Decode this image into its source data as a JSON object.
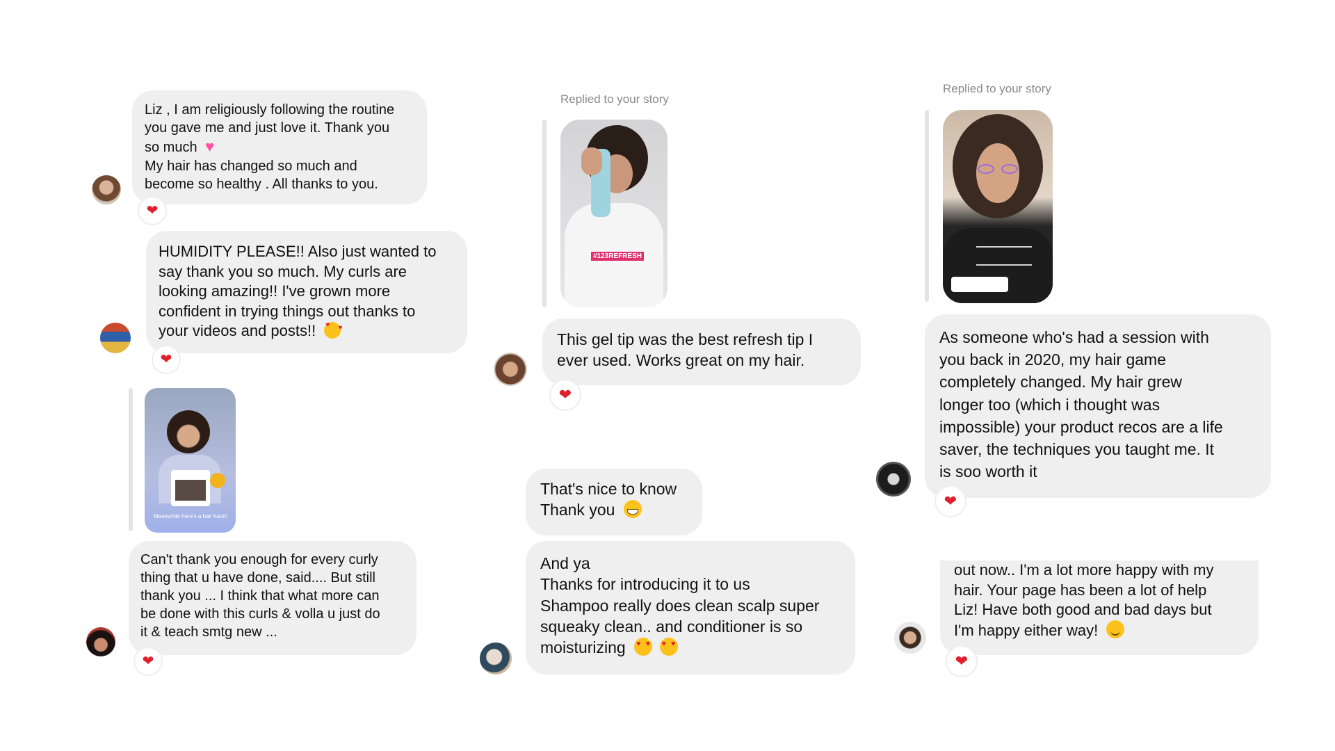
{
  "col1": {
    "msg1": {
      "lines": [
        "Liz , I am religiously following the routine",
        "you gave me and just love it. Thank you",
        "so much",
        "My hair has changed so much and",
        "become so healthy . All thanks to you."
      ],
      "emoji": "pink-heart"
    },
    "msg2": {
      "lines": [
        "HUMIDITY PLEASE!! Also just wanted to",
        "say thank you so much. My curls are",
        "looking amazing!! I've grown more",
        "confident in trying things out thanks to",
        "your videos and posts!!"
      ],
      "emoji": "smiling-face-with-hearts"
    },
    "story": {
      "caption": "Meanwhile here's a hair hack!"
    },
    "msg3": {
      "lines": [
        "Can't thank you enough for every curly",
        "thing that u have done, said....  But still",
        "thank you ... I think that what more can",
        "be done with this curls & volla u just do",
        "it & teach smtg new ..."
      ]
    }
  },
  "col2": {
    "replied_label": "Replied to your story",
    "story": {
      "tag": "#123REFRESH"
    },
    "msg1": {
      "lines": [
        "This gel tip was the best refresh tip I",
        "ever used. Works great on my hair."
      ]
    },
    "msg2": {
      "lines": [
        "That's nice to know",
        "Thank you"
      ],
      "emoji": "grinning-face"
    },
    "msg3": {
      "lines": [
        "And ya",
        "Thanks for introducing it to us",
        "Shampoo really does clean scalp super",
        "squeaky clean.. and conditioner is so",
        "moisturizing"
      ],
      "emoji": "heart-eyes"
    }
  },
  "col3": {
    "replied_label": "Replied to your story",
    "story": {},
    "msg1": {
      "lines": [
        "As someone who's had a session with",
        "you back in 2020, my hair game",
        "completely changed. My hair grew",
        "longer too (which i thought was",
        "impossible) your product recos are a life",
        "saver, the techniques you taught me. It",
        "is soo worth it"
      ]
    },
    "msg2": {
      "lines": [
        "out now.. I'm a lot more happy with my",
        "hair. Your page has been a lot of help",
        "Liz! Have both good and bad days but",
        "I'm happy either way!"
      ],
      "emoji": "smiling-face"
    }
  },
  "reaction_emoji": "❤",
  "colors": {
    "bubble": "#efefef",
    "heart": "#e0202c",
    "meta_text": "#8a8a8a",
    "reply_bar": "#e4e4e4"
  }
}
